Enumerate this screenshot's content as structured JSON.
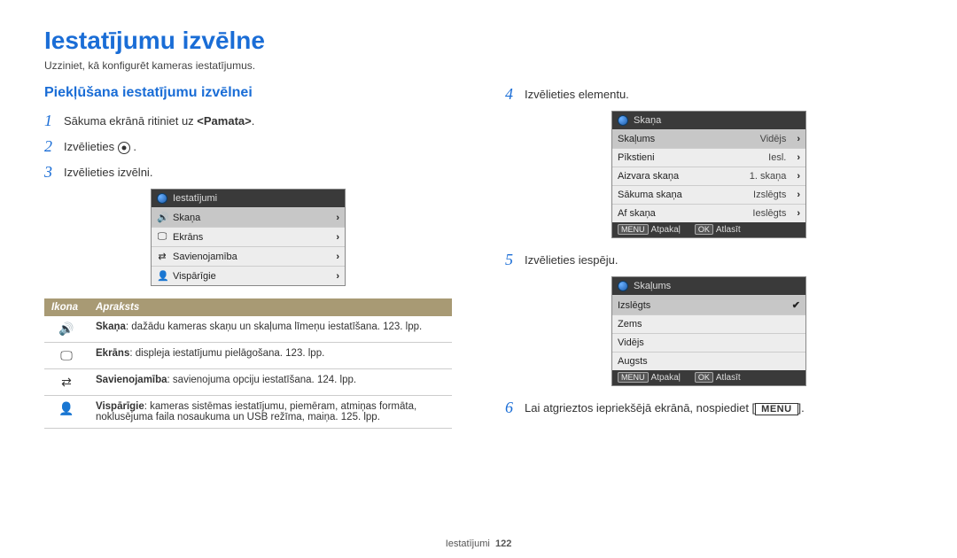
{
  "page_title": "Iestatījumu izvēlne",
  "intro": "Uzziniet, kā konfigurēt kameras iestatījumus.",
  "section_heading": "Piekļūšana iestatījumu izvēlnei",
  "steps": {
    "s1_pre": "Sākuma ekrānā ritiniet uz ",
    "s1_bold": "<Pamata>",
    "s1_post": ".",
    "s2": "Izvēlieties ",
    "s2_post": ".",
    "s3": "Izvēlieties izvēlni.",
    "s4": "Izvēlieties elementu.",
    "s5": "Izvēlieties iespēju.",
    "s6_pre": "Lai atgrieztos iepriekšējā ekrānā, nospiediet [",
    "s6_btn": "MENU",
    "s6_post": "]."
  },
  "menu1": {
    "header": "Iestatījumi",
    "items": [
      {
        "icon": "🔊",
        "label": "Skaņa"
      },
      {
        "icon": "🖵",
        "label": "Ekrāns"
      },
      {
        "icon": "⇄",
        "label": "Savienojamība"
      },
      {
        "icon": "👤",
        "label": "Vispārīgie"
      }
    ]
  },
  "menu2": {
    "header": "Skaņa",
    "rows": [
      {
        "label": "Skaļums",
        "value": "Vidējs",
        "sel": true
      },
      {
        "label": "Pīkstieni",
        "value": "Iesl."
      },
      {
        "label": "Aizvara skaņa",
        "value": "1. skaņa"
      },
      {
        "label": "Sākuma skaņa",
        "value": "Izslēgts"
      },
      {
        "label": "Af skaņa",
        "value": "Ieslēgts"
      }
    ],
    "footer_back_lbl": "MENU",
    "footer_back": "Atpakaļ",
    "footer_ok_lbl": "OK",
    "footer_ok": "Atlasīt"
  },
  "menu3": {
    "header": "Skaļums",
    "rows": [
      {
        "label": "Izslēgts",
        "sel": true,
        "check": true
      },
      {
        "label": "Zems"
      },
      {
        "label": "Vidējs"
      },
      {
        "label": "Augsts"
      }
    ],
    "footer_back_lbl": "MENU",
    "footer_back": "Atpakaļ",
    "footer_ok_lbl": "OK",
    "footer_ok": "Atlasīt"
  },
  "table": {
    "head_icon": "Ikona",
    "head_desc": "Apraksts",
    "rows": [
      {
        "icon": "🔊",
        "bold": "Skaņa",
        "text": ": dažādu kameras skaņu un skaļuma līmeņu iestatīšana. 123. lpp."
      },
      {
        "icon": "🖵",
        "bold": "Ekrāns",
        "text": ": displeja iestatījumu pielāgošana. 123. lpp."
      },
      {
        "icon": "⇄",
        "bold": "Savienojamība",
        "text": ": savienojuma opciju iestatīšana. 124. lpp."
      },
      {
        "icon": "👤",
        "bold": "Vispārīgie",
        "text": ": kameras sistēmas iestatījumu, piemēram, atmiņas formāta, noklusējuma faila nosaukuma un USB režīma, maiņa. 125. lpp."
      }
    ]
  },
  "footer": {
    "section": "Iestatījumi",
    "page": "122"
  }
}
